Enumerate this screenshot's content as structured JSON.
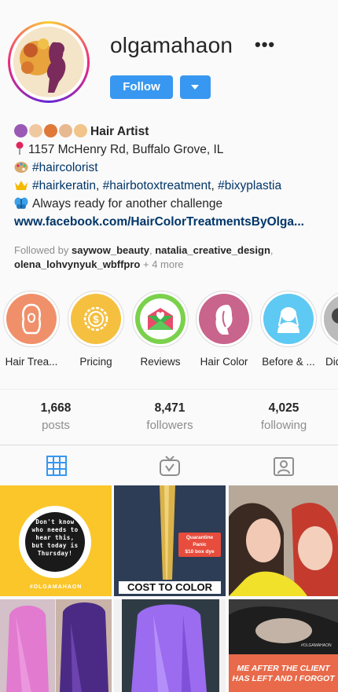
{
  "profile": {
    "username": "olgamahaon",
    "more_label": "•••",
    "follow_label": "Follow"
  },
  "bio": {
    "title": "Hair Artist",
    "address": "1157 McHenry Rd, Buffalo Grove, IL",
    "tag1": "#haircolorist",
    "tag2": "#hairkeratin",
    "tag3": "#hairbotoxtreatment",
    "tag4": "#bixyplastia",
    "sep": ", ",
    "line5": "Always ready for another challenge",
    "website": "www.facebook.com/HairColorTreatmentsByOlga..."
  },
  "followed_by": {
    "prefix": "Followed by ",
    "user1": "saywow_beauty",
    "user2": "natalia_creative_design",
    "user3": "olena_lohvynyuk_wbffpro",
    "comma": ", ",
    "more": " + 4 more"
  },
  "highlights": [
    {
      "label": "Hair Trea..."
    },
    {
      "label": "Pricing"
    },
    {
      "label": "Reviews"
    },
    {
      "label": "Hair Color"
    },
    {
      "label": "Before & ..."
    },
    {
      "label": "Did"
    }
  ],
  "stats": {
    "posts": {
      "value": "1,668",
      "label": "posts"
    },
    "followers": {
      "value": "8,471",
      "label": "followers"
    },
    "following": {
      "value": "4,025",
      "label": "following"
    }
  },
  "posts": {
    "p1_text": "Don't know who needs to hear this, but today is Thursday!",
    "p1_tag": "#OLGAMAHAON",
    "p2_sticker1": "Quarantine Panic",
    "p2_sticker2": "$10 box dye",
    "p2_caption": "COST TO COLOR",
    "p6_caption1": "ME AFTER THE CLIENT",
    "p6_caption2": "HAS LEFT AND I FORGOT",
    "p6_watermark": "#OLGAMAHAON"
  },
  "colors": {
    "accent": "#3897f0",
    "highlight_1": "#f0906a",
    "highlight_2": "#f5c040",
    "highlight_3": "#7bd14c",
    "highlight_4": "#c9648c",
    "highlight_5": "#5ec9f3"
  },
  "icons": {
    "more": "ellipsis-icon",
    "dropdown": "caret-down-icon",
    "pin": "map-pin-icon",
    "palette": "palette-icon",
    "crown": "crown-icon",
    "butterfly": "butterfly-icon",
    "grid_tab": "grid-icon",
    "igtv_tab": "igtv-icon",
    "tagged_tab": "tagged-icon"
  }
}
